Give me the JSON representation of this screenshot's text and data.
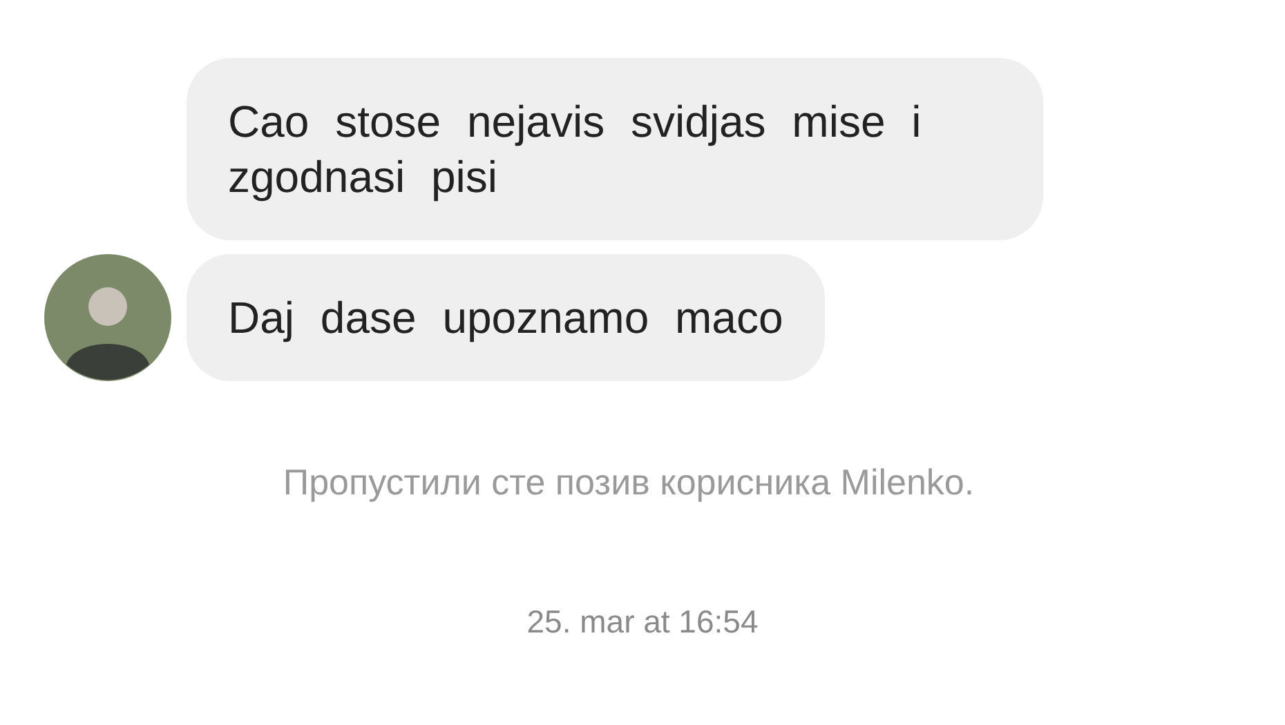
{
  "messages": [
    {
      "text": "Cao stose nejavis svidjas mise i zgodnasi pisi",
      "avatar": false
    },
    {
      "text": "Daj dase upoznamo maco",
      "avatar": true
    }
  ],
  "system_message": "Пропустили сте позив корисника Milenko.",
  "timestamp": "25. mar at 16:54"
}
